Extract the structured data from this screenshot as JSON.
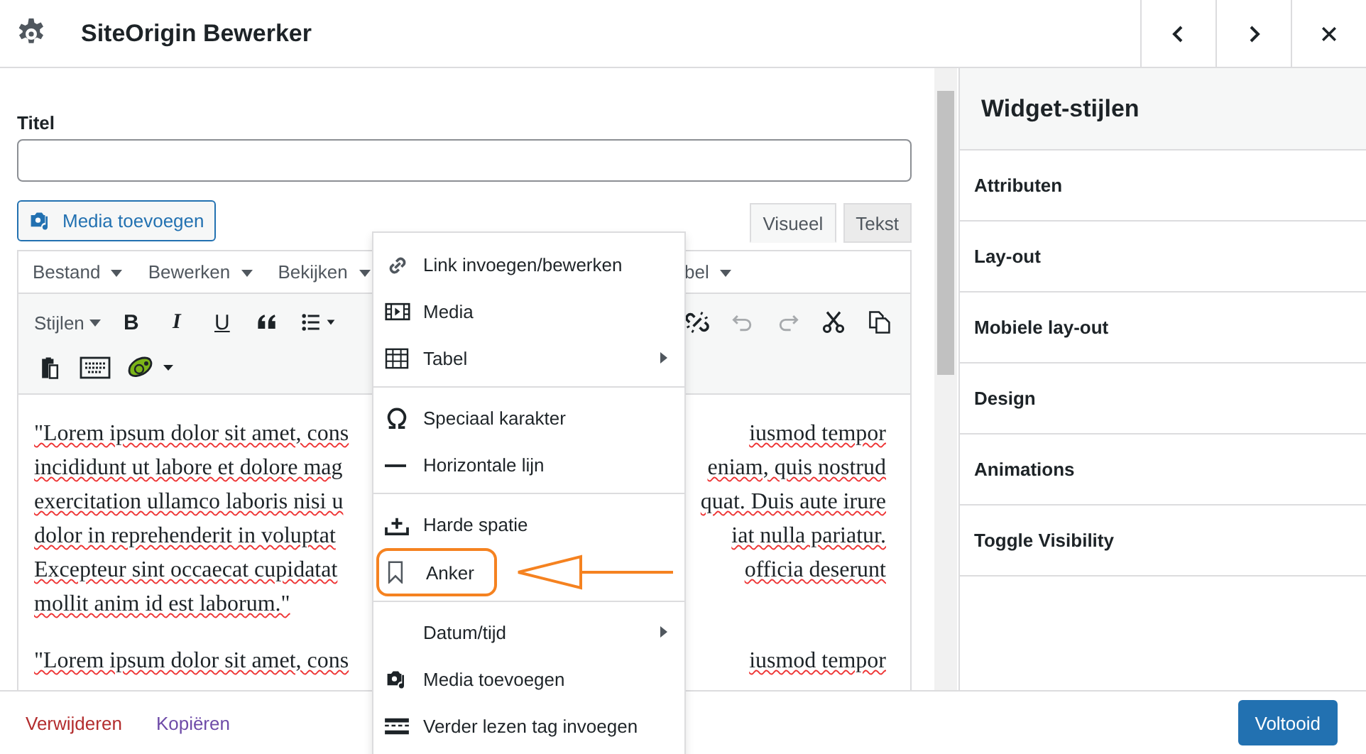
{
  "header": {
    "title": "SiteOrigin Bewerker"
  },
  "form": {
    "title_label": "Titel",
    "media_button": "Media toevoegen",
    "editor_tabs": [
      {
        "label": "Visueel",
        "selected": true
      },
      {
        "label": "Tekst",
        "selected": false
      }
    ],
    "menubar": [
      "Bestand",
      "Bewerken",
      "Bekijken",
      "bel"
    ],
    "toolbar_row1": [
      {
        "kind": "dropdown",
        "label": "Stijlen"
      },
      {
        "kind": "bold",
        "label": "B"
      },
      {
        "kind": "italic",
        "label": "I"
      },
      {
        "kind": "underline",
        "label": "U"
      },
      {
        "kind": "quote"
      },
      {
        "kind": "list"
      }
    ],
    "toolbar_row1_right": [
      {
        "kind": "unlink"
      },
      {
        "kind": "undo"
      },
      {
        "kind": "redo"
      },
      {
        "kind": "cut"
      },
      {
        "kind": "copy"
      }
    ],
    "toolbar_row2": [
      {
        "kind": "paste"
      },
      {
        "kind": "keyboard"
      },
      {
        "kind": "plugin"
      }
    ],
    "paragraphs": [
      [
        {
          "left": "\"Lorem ipsum dolor sit amet, cons",
          "right": "iusmod tempor"
        },
        {
          "left": "incididunt ut labore et dolore mag",
          "right": "eniam, quis nostrud"
        },
        {
          "left": "exercitation ullamco laboris nisi u",
          "right": "quat. Duis aute irure"
        },
        {
          "left": "dolor in reprehenderit in voluptat",
          "right": "iat nulla pariatur."
        },
        {
          "left": "Excepteur sint occaecat cupidatat",
          "right": "officia deserunt"
        },
        {
          "left": "mollit anim id est laborum.\""
        }
      ],
      [
        {
          "left": "\"Lorem ipsum dolor sit amet, cons",
          "right": "iusmod tempor"
        }
      ]
    ]
  },
  "context_menu": [
    [
      {
        "label": "Link invoegen/bewerken",
        "kind": "link",
        "submenu": false,
        "annotated": false
      },
      {
        "label": "Media",
        "kind": "film",
        "submenu": false,
        "annotated": false
      },
      {
        "label": "Tabel",
        "kind": "table",
        "submenu": true,
        "annotated": false
      }
    ],
    [
      {
        "label": "Speciaal karakter",
        "kind": "omega",
        "submenu": false,
        "annotated": false
      },
      {
        "label": "Horizontale lijn",
        "kind": "hr",
        "submenu": false,
        "annotated": false
      }
    ],
    [
      {
        "label": "Harde spatie",
        "kind": "nbsp",
        "submenu": false,
        "annotated": false
      },
      {
        "label": "Anker",
        "kind": "anchor",
        "submenu": false,
        "annotated": true
      }
    ],
    [
      {
        "label": "Datum/tijd",
        "kind": "none",
        "submenu": true,
        "annotated": false
      },
      {
        "label": "Media toevoegen",
        "kind": "media",
        "submenu": false,
        "annotated": false
      },
      {
        "label": "Verder lezen tag invoegen",
        "kind": "more",
        "submenu": false,
        "annotated": false
      }
    ]
  ],
  "sidebar": {
    "title": "Widget-stijlen",
    "sections": [
      "Attributen",
      "Lay-out",
      "Mobiele lay-out",
      "Design",
      "Animations",
      "Toggle Visibility"
    ]
  },
  "footer": {
    "delete_link": "Verwijderen",
    "copy_link": "Kopiëren",
    "done_button": "Voltooid"
  }
}
